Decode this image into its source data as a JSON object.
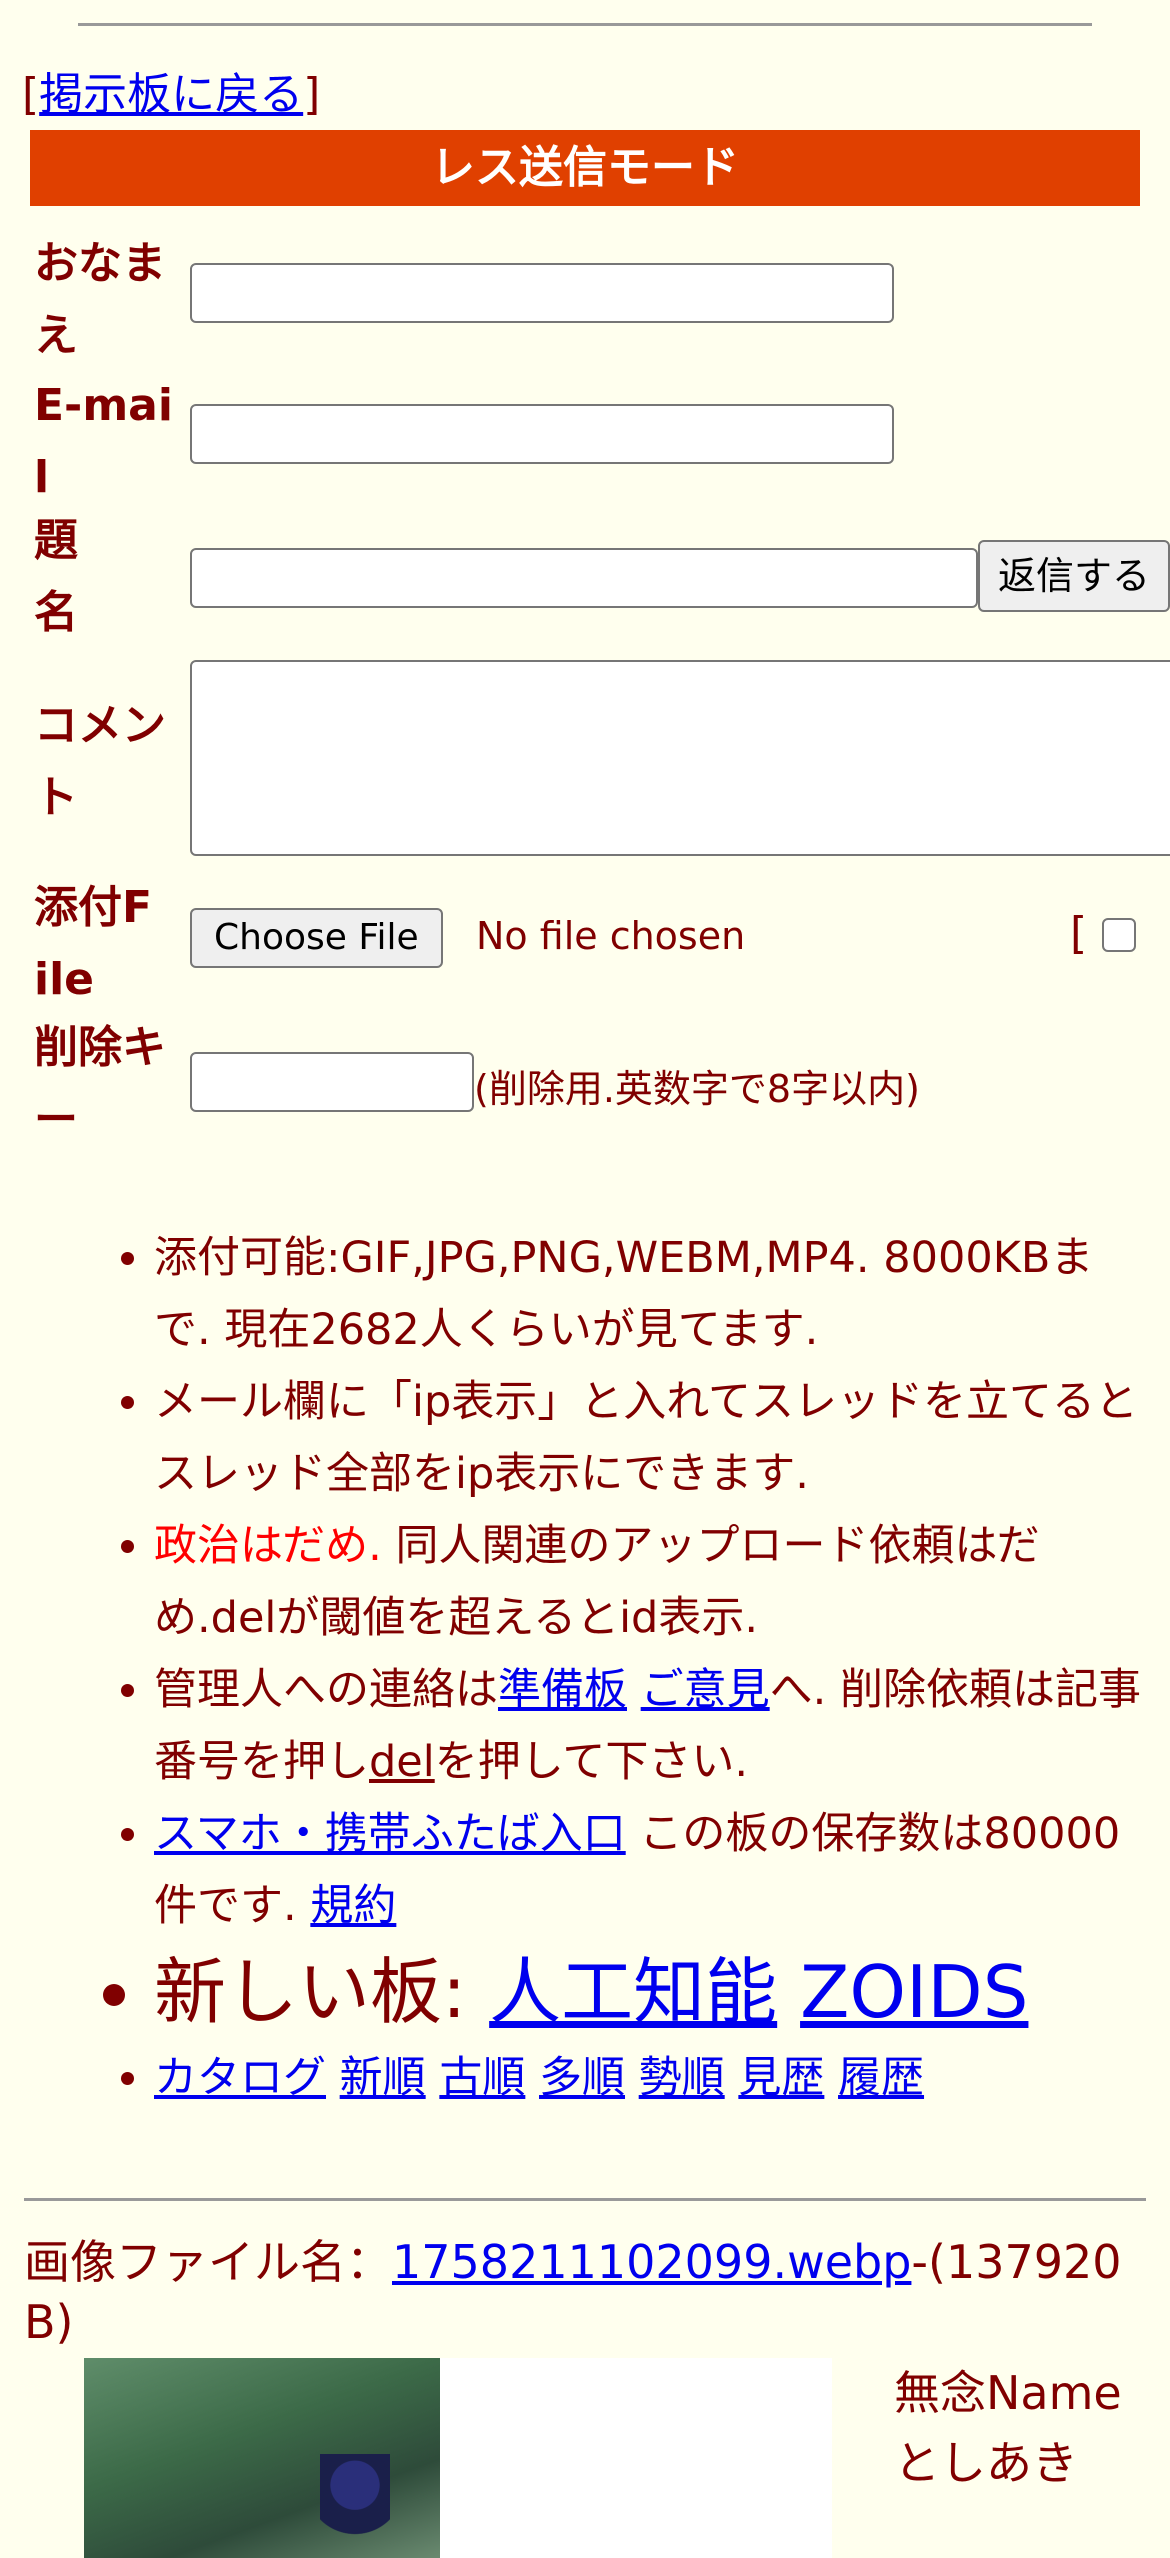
{
  "nav": {
    "open_bracket": "[",
    "back_link": "掲示板に戻る",
    "close_bracket": "]"
  },
  "form": {
    "mode_title": "レス送信モード",
    "name_label": "おなまえ",
    "email_label": "E-mail",
    "subject_label": "題名",
    "submit_label": "返信する",
    "comment_label": "コメント",
    "attach_label": "添付File",
    "choose_file_label": "Choose File",
    "no_file_text": "No file chosen",
    "image_toggle_prefix": "[",
    "delkey_label": "削除キー",
    "delkey_hint": "(削除用.英数字で8字以内)"
  },
  "rules": {
    "r1": "添付可能:GIF,JPG,PNG,WEBM,MP4. 8000KBまで. 現在2682人くらいが見てます.",
    "r2": "メール欄に「ip表示」と入れてスレッドを立てるとスレッド全部をip表示にできます.",
    "r3_red": "政治はだめ.",
    "r3_rest": " 同人関連のアップロード依頼はだめ.delが閾値を超えるとid表示.",
    "r4_a": "管理人への連絡は",
    "r4_link1": "準備板",
    "r4_link2": "ご意見",
    "r4_b": "へ. 削除依頼は記事番号を押し",
    "r4_link3": "del",
    "r4_c": "を押して下さい.",
    "r5_link": "スマホ・携帯ふたば入口",
    "r5_text": " この板の保存数は80000件です. ",
    "r5_link2": "規約",
    "r6_text": "新しい板: ",
    "r6_link1": "人工知能",
    "r6_link2": "ZOIDS",
    "sort_links": [
      "カタログ",
      "新順",
      "古順",
      "多順",
      "勢順",
      "見歴",
      "履歴"
    ]
  },
  "post": {
    "file_label": "画像ファイル名：",
    "file_name": "1758211102099.webp",
    "file_suffix": "-(137920 B)",
    "poster_line1": "無念Name",
    "poster_line2": "としあき"
  }
}
